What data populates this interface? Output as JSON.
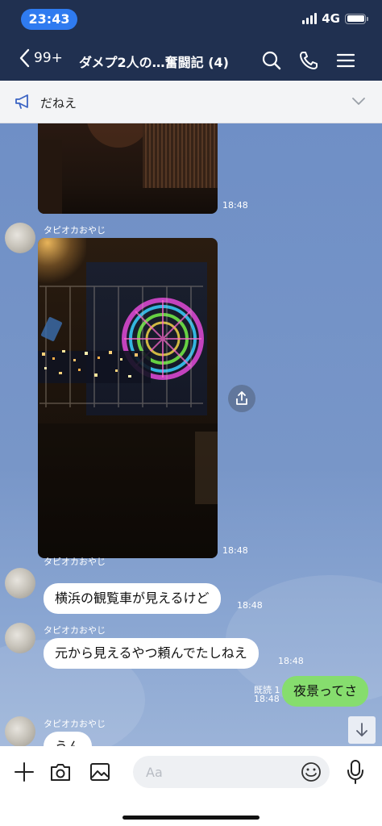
{
  "status_bar": {
    "time": "23:43",
    "network": "4G"
  },
  "header": {
    "back_count": "99+",
    "title": "ダメプ2人の…奮闘記 (4)"
  },
  "announcement": {
    "text": "だねえ"
  },
  "messages": [
    {
      "type": "photo",
      "time": "18:48"
    },
    {
      "type": "photo",
      "sender": "タピオカおやじ",
      "time": "18:48"
    },
    {
      "type": "text",
      "sender": "タピオカおやじ",
      "text": "横浜の観覧車が見えるけど",
      "time": "18:48"
    },
    {
      "type": "text",
      "sender": "タピオカおやじ",
      "text": "元から見えるやつ頼んでたしねえ",
      "time": "18:48"
    },
    {
      "type": "outgoing",
      "read": "既読 1",
      "text": "夜景ってさ",
      "time": "18:48"
    },
    {
      "type": "text",
      "sender": "タピオカおやじ",
      "text": "うん"
    }
  ],
  "input": {
    "placeholder": "Aa"
  },
  "colors": {
    "header": "#203050",
    "chat_bg": "#7391c4",
    "outgoing_bubble": "#86dd6e",
    "time_pill": "#2f7bf0"
  }
}
